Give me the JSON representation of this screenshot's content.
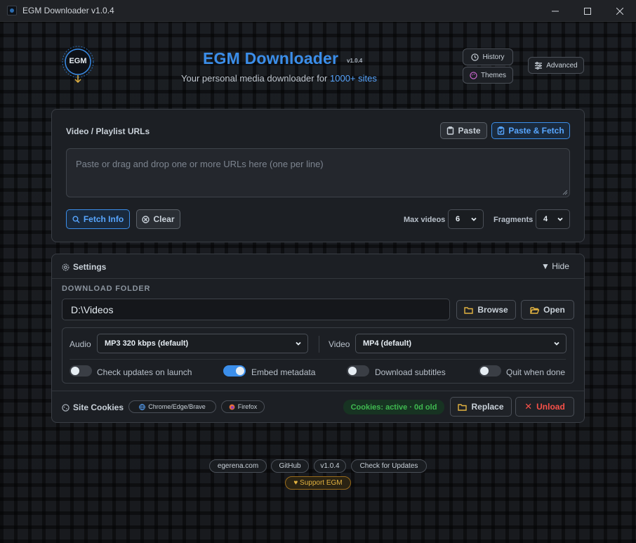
{
  "window": {
    "title": "EGM Downloader v1.0.4"
  },
  "header": {
    "logo_text": "EGM",
    "app_title": "EGM Downloader",
    "version": "v1.0.4",
    "subtitle_prefix": "Your personal media downloader for",
    "subtitle_highlight": "1000+ sites",
    "history_label": "History",
    "themes_label": "Themes",
    "advanced_label": "Advanced"
  },
  "urls": {
    "section_label": "Video / Playlist URLs",
    "paste_label": "Paste",
    "paste_fetch_label": "Paste & Fetch",
    "textarea_placeholder": "Paste or drag and drop one or more URLs here (one per line)",
    "fetch_info_label": "Fetch Info",
    "clear_label": "Clear",
    "max_videos_label": "Max videos",
    "max_videos_value": "6",
    "fragments_label": "Fragments",
    "fragments_value": "4"
  },
  "settings": {
    "title": "Settings",
    "hide_label": "▼ Hide",
    "download_folder_label": "DOWNLOAD FOLDER",
    "folder_value": "D:\\Videos",
    "browse_label": "Browse",
    "open_label": "Open",
    "audio_label": "Audio",
    "audio_value": "MP3 320 kbps (default)",
    "video_label": "Video",
    "video_value": "MP4 (default)",
    "toggles": [
      {
        "label": "Check updates on launch",
        "on": false
      },
      {
        "label": "Embed metadata",
        "on": true
      },
      {
        "label": "Download subtitles",
        "on": false
      },
      {
        "label": "Quit when done",
        "on": false
      }
    ],
    "site_cookies_label": "Site Cookies",
    "browser_chip_label": "Chrome/Edge/Brave",
    "firefox_chip_label": "Firefox",
    "cookies_status": "Cookies: active · 0d old",
    "replace_label": "Replace",
    "unload_label": "Unload"
  },
  "footer": {
    "links": [
      "egerena.com",
      "GitHub",
      "v1.0.4",
      "Check for Updates"
    ],
    "support_label": "♥ Support EGM"
  },
  "colors": {
    "accent": "#3b8eea",
    "success": "#3fb950",
    "danger": "#f85149",
    "folder": "#e3b341"
  }
}
